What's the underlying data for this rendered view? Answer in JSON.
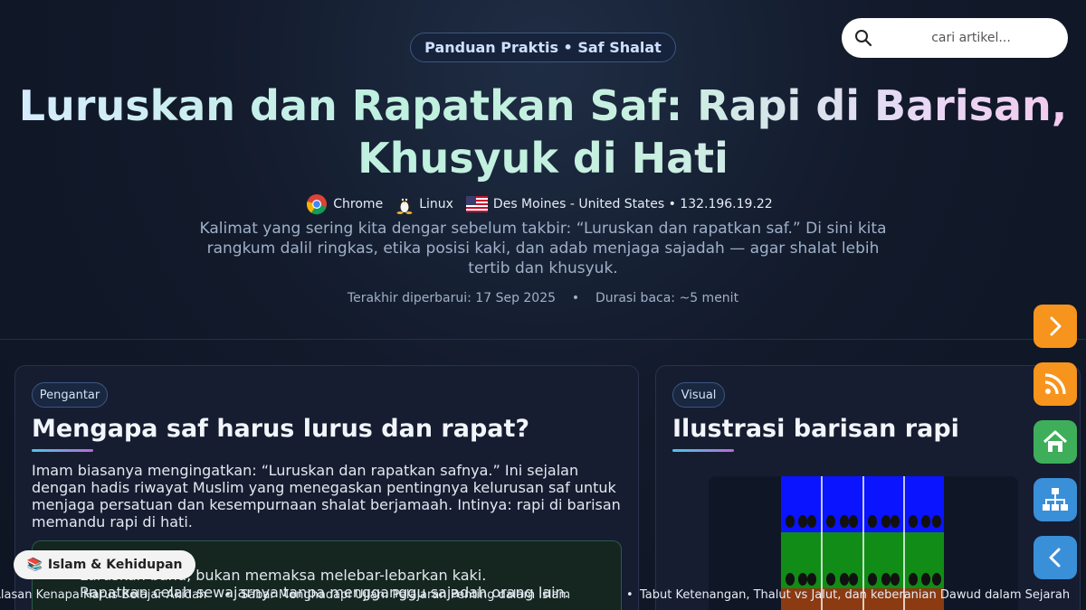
{
  "header": {
    "badge": "Panduan Praktis • Saf Shalat",
    "search_placeholder": "cari artikel...",
    "title_line1": "Luruskan dan Rapatkan Saf: Rapi di Barisan,",
    "title_line2": "Khusyuk di Hati",
    "visitor": {
      "browser": "Chrome",
      "os": "Linux",
      "location": "Des Moines - United States • 132.196.19.22"
    },
    "subtitle": "Kalimat yang sering kita dengar sebelum takbir: “Luruskan dan rapatkan saf.” Di sini kita rangkum dalil ringkas, etika posisi kaki, dan adab menjaga sajadah — agar shalat lebih tertib dan khusyuk.",
    "updated": "Terakhir diperbarui: 17 Sep 2025",
    "separator": "•",
    "reading_time": "Durasi baca: ~5 menit"
  },
  "card_intro": {
    "tag": "Pengantar",
    "heading": "Mengapa saf harus lurus dan rapat?",
    "body": "Imam biasanya mengingatkan: “Luruskan dan rapatkan safnya.” Ini sejalan dengan hadis riwayat Muslim yang menegaskan pentingnya kelurusan saf untuk menjaga persatuan dan kesempurnaan shalat berjamaah. Intinya: rapi di barisan memandu rapi di hati.",
    "callout_line1": "Luruskan bahu, bukan memaksa melebar-lebarkan kaki.",
    "callout_line2": "Rapatkan celah sewajarnya tanpa mengganggu sajadah orang lain."
  },
  "card_visual": {
    "tag": "Visual",
    "heading": "Ilustrasi barisan rapi"
  },
  "category_chip": {
    "icon": "books-icon",
    "label": "Islam & Kehidupan"
  },
  "ticker": {
    "items": [
      "Alasan Kenapa Harus Belajar Akidah",
      "Sabar Menghadapi Ujian: Pelajaran Penting dalam Islam",
      "Tabut Ketenangan, Thalut vs Jalut, dan keberanian Dawud dalam Sejarah"
    ],
    "bullet": "•"
  },
  "fabs": [
    {
      "icon": "chevron-right-icon",
      "color": "#f7941d"
    },
    {
      "icon": "rss-icon",
      "color": "#f7941d"
    },
    {
      "icon": "home-icon",
      "color": "#3fae5a"
    },
    {
      "icon": "sitemap-icon",
      "color": "#3a8fd9"
    },
    {
      "icon": "chevron-left-icon",
      "color": "#3a8fd9"
    }
  ],
  "colors": {
    "background": "#121a2b",
    "card": "#161d31",
    "accent_gradient_start": "#4cc6e8",
    "accent_gradient_end": "#b86ad8",
    "orange": "#f7941d",
    "green": "#3fae5a",
    "blue": "#3a8fd9"
  }
}
